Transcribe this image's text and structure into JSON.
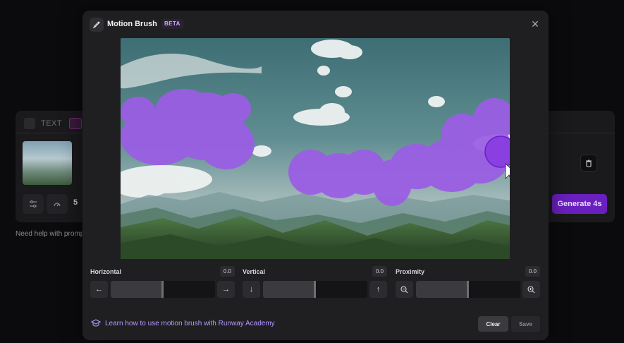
{
  "background": {
    "tab_text_label": "TEXT",
    "duration_value": "5",
    "generate_label": "Generate 4s",
    "help_text": "Need help with promp"
  },
  "modal": {
    "title": "Motion Brush",
    "badge": "BETA",
    "controls": [
      {
        "label": "Horizontal",
        "value": "0.0",
        "left_icon": "←",
        "right_icon": "→",
        "level": 0.5
      },
      {
        "label": "Vertical",
        "value": "0.0",
        "left_icon": "↓",
        "right_icon": "↑",
        "level": 0.5
      },
      {
        "label": "Proximity",
        "value": "0.0",
        "left_icon": "zoom-out-icon",
        "right_icon": "zoom-in-icon",
        "level": 0.5
      }
    ],
    "footer_link": "Learn how to use motion brush with Runway Academy",
    "clear_label": "Clear",
    "save_label": "Save"
  },
  "colors": {
    "accent": "#6a1fbf",
    "brush_stroke": "#9b5de5",
    "link": "#b598ff"
  }
}
